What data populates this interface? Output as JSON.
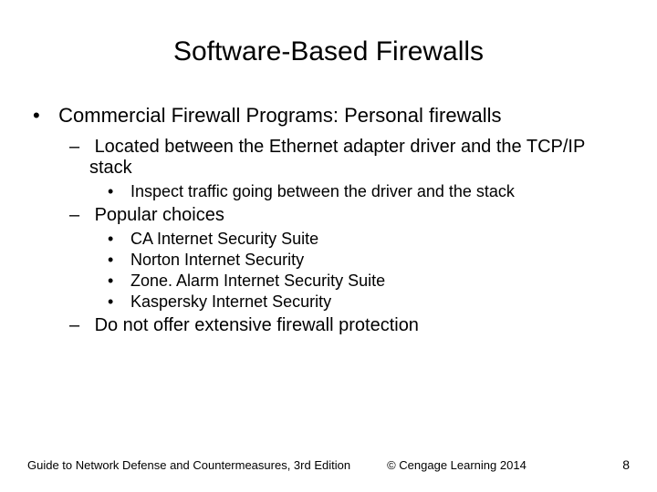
{
  "title": "Software-Based Firewalls",
  "bullets": {
    "b1": "Commercial Firewall Programs: Personal firewalls",
    "b1_1": "Located between the Ethernet adapter driver and the TCP/IP stack",
    "b1_1_1": "Inspect traffic going between the driver and the stack",
    "b1_2": "Popular choices",
    "b1_2_1": "CA Internet Security Suite",
    "b1_2_2": "Norton Internet Security",
    "b1_2_3": "Zone. Alarm Internet Security Suite",
    "b1_2_4": "Kaspersky Internet Security",
    "b1_3": "Do not offer extensive firewall protection"
  },
  "footer": {
    "left": "Guide to Network Defense and Countermeasures, 3rd Edition",
    "center": "© Cengage Learning  2014",
    "page": "8"
  }
}
